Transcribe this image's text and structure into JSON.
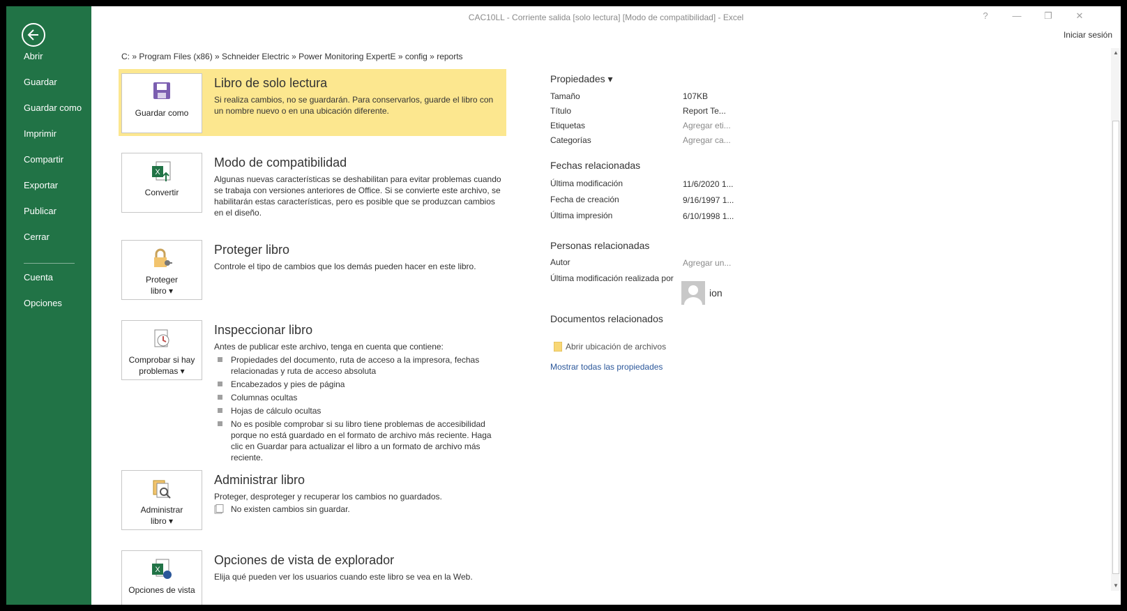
{
  "window": {
    "title": "CAC10LL - Corriente salida  [solo lectura]  [Modo de compatibilidad] - Excel",
    "sign_in": "Iniciar sesión",
    "help": "?",
    "minimize": "—",
    "restore": "❐",
    "close": "✕"
  },
  "sidebar": {
    "items": [
      {
        "label": "Abrir"
      },
      {
        "label": "Guardar"
      },
      {
        "label": "Guardar como"
      },
      {
        "label": "Imprimir"
      },
      {
        "label": "Compartir"
      },
      {
        "label": "Exportar"
      },
      {
        "label": "Publicar"
      },
      {
        "label": "Cerrar"
      },
      {
        "label": "Cuenta"
      },
      {
        "label": "Opciones"
      }
    ]
  },
  "breadcrumb": "C: » Program Files (x86) » Schneider Electric » Power Monitoring ExpertE » config » reports",
  "sections": {
    "readonly": {
      "button": "Guardar como",
      "title": "Libro de solo lectura",
      "desc": "Si realiza cambios, no se guardarán. Para conservarlos, guarde el libro con un nombre nuevo o en una ubicación diferente."
    },
    "compat": {
      "button": "Convertir",
      "title": "Modo de compatibilidad",
      "desc": "Algunas nuevas características se deshabilitan para evitar problemas cuando se trabaja con versiones anteriores de Office. Si se convierte este archivo, se habilitarán estas características, pero es posible que se produzcan cambios en el diseño."
    },
    "protect": {
      "button_line1": "Proteger",
      "button_line2": "libro ▾",
      "title": "Proteger libro",
      "desc": "Controle el tipo de cambios que los demás pueden hacer en este libro."
    },
    "inspect": {
      "button_line1": "Comprobar si hay",
      "button_line2": "problemas ▾",
      "title": "Inspeccionar libro",
      "desc": "Antes de publicar este archivo, tenga en cuenta que contiene:",
      "bullets": [
        "Propiedades del documento, ruta de acceso a la impresora, fechas relacionadas y ruta de acceso absoluta",
        "Encabezados y pies de página",
        "Columnas ocultas",
        "Hojas de cálculo ocultas",
        "No es posible comprobar si su libro tiene problemas de accesibilidad porque no está guardado en el formato de archivo más reciente. Haga clic en Guardar para actualizar el libro a un formato de archivo más reciente."
      ]
    },
    "manage": {
      "button_line1": "Administrar",
      "button_line2": "libro ▾",
      "title": "Administrar libro",
      "desc": "Proteger, desproteger y recuperar los cambios no guardados.",
      "note": "No existen cambios sin guardar."
    },
    "browser": {
      "button": "Opciones de vista",
      "title": "Opciones de vista de explorador",
      "desc": "Elija qué pueden ver los usuarios cuando este libro se vea en la Web."
    }
  },
  "properties": {
    "heading": "Propiedades ▾",
    "rows": [
      {
        "label": "Tamaño",
        "value": "107KB"
      },
      {
        "label": "Título",
        "value": "Report Te..."
      },
      {
        "label": "Etiquetas",
        "value": "Agregar eti..."
      },
      {
        "label": "Categorías",
        "value": "Agregar ca..."
      }
    ],
    "dates_heading": "Fechas relacionadas",
    "dates": [
      {
        "label": "Última modificación",
        "value": "11/6/2020 1..."
      },
      {
        "label": "Fecha de creación",
        "value": "9/16/1997 1..."
      },
      {
        "label": "Última impresión",
        "value": "6/10/1998 1..."
      }
    ],
    "people_heading": "Personas relacionadas",
    "author_label": "Autor",
    "author_value": "Agregar un...",
    "modified_by_label": "Última modificación realizada por",
    "modified_by_name": "ion",
    "docs_heading": "Documentos relacionados",
    "open_location": "Abrir ubicación de archivos",
    "show_all": "Mostrar todas las propiedades"
  }
}
